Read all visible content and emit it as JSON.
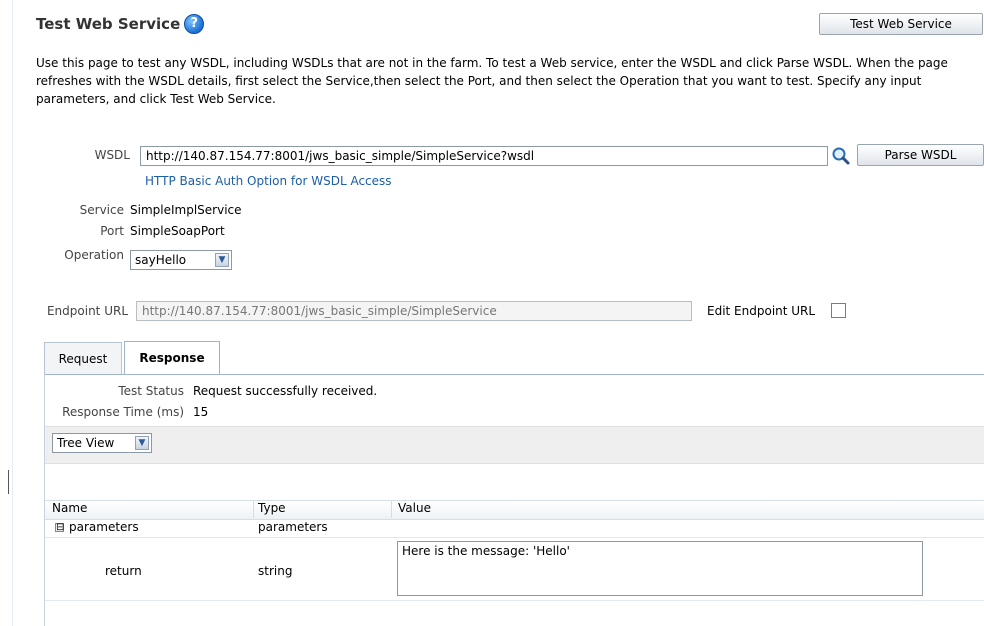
{
  "header": {
    "title": "Test Web Service",
    "help_glyph": "?",
    "test_button_label": "Test Web Service"
  },
  "description": "Use this page to test any WSDL, including WSDLs that are not in the farm. To test a Web service, enter the WSDL and click Parse WSDL. When the page refreshes with the WSDL details, first select the Service,then select the Port, and then select the Operation that you want to test. Specify any input parameters, and click Test Web Service.",
  "wsdl": {
    "label": "WSDL",
    "value": "http://140.87.154.77:8001/jws_basic_simple/SimpleService?wsdl",
    "parse_button_label": "Parse WSDL",
    "auth_link": "HTTP Basic Auth Option for WSDL Access",
    "search_icon": "magnifier-search-icon"
  },
  "service": {
    "label": "Service",
    "value": "SimpleImplService"
  },
  "port": {
    "label": "Port",
    "value": "SimpleSoapPort"
  },
  "operation": {
    "label": "Operation",
    "selected": "sayHello"
  },
  "endpoint": {
    "label": "Endpoint URL",
    "value": "http://140.87.154.77:8001/jws_basic_simple/SimpleService",
    "edit_label": "Edit Endpoint URL",
    "edit_checked": false
  },
  "tabs": [
    {
      "label": "Request",
      "active": false
    },
    {
      "label": "Response",
      "active": true
    }
  ],
  "response": {
    "status_label": "Test Status",
    "status_value": "Request successfully received.",
    "time_label": "Response Time (ms)",
    "time_value": "15",
    "view_selected": "Tree View"
  },
  "table": {
    "columns": [
      "Name",
      "Type",
      "Value"
    ],
    "rows": [
      {
        "name": "parameters",
        "type": "parameters",
        "value": "",
        "expander": "⊟"
      },
      {
        "name": "return",
        "type": "string",
        "value": "Here is the message: 'Hello'"
      }
    ]
  },
  "colors": {
    "link": "#1c5ea8",
    "tab_border": "#9fb4c9",
    "help_icon": "#1b6ed6"
  }
}
